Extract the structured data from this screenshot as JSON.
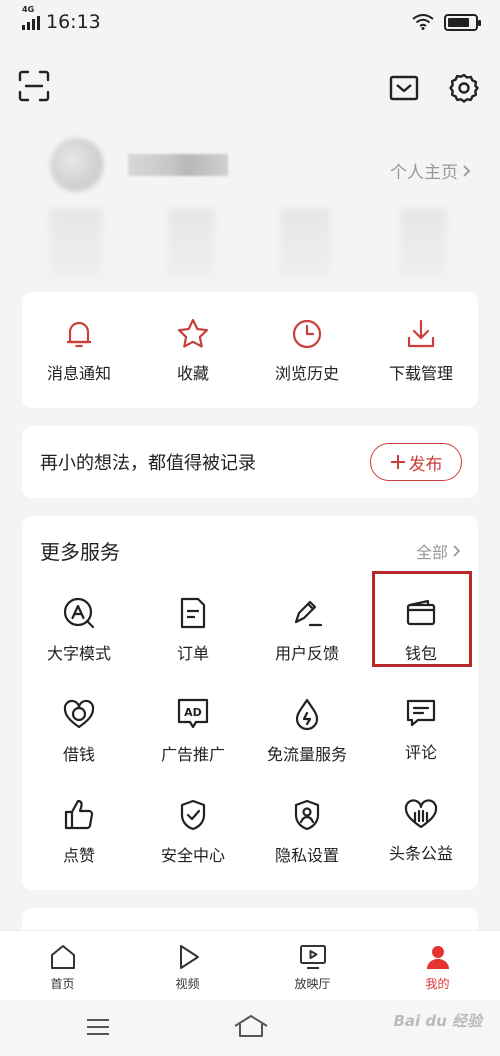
{
  "status_bar": {
    "time": "16:13",
    "network": "4G"
  },
  "profile": {
    "homepage_link": "个人主页"
  },
  "quick_actions": [
    {
      "label": "消息通知",
      "icon": "bell-icon"
    },
    {
      "label": "收藏",
      "icon": "star-icon"
    },
    {
      "label": "浏览历史",
      "icon": "clock-icon"
    },
    {
      "label": "下载管理",
      "icon": "download-icon"
    }
  ],
  "post_bar": {
    "prompt": "再小的想法，都值得被记录",
    "button_label": "发布"
  },
  "services": {
    "title": "更多服务",
    "all_label": "全部",
    "items": [
      {
        "label": "大字模式",
        "icon": "font-size-icon"
      },
      {
        "label": "订单",
        "icon": "order-icon"
      },
      {
        "label": "用户反馈",
        "icon": "feedback-pen-icon"
      },
      {
        "label": "钱包",
        "icon": "wallet-icon"
      },
      {
        "label": "借钱",
        "icon": "loan-icon"
      },
      {
        "label": "广告推广",
        "icon": "ad-icon"
      },
      {
        "label": "免流量服务",
        "icon": "drop-icon"
      },
      {
        "label": "评论",
        "icon": "comment-icon"
      },
      {
        "label": "点赞",
        "icon": "thumbs-up-icon"
      },
      {
        "label": "安全中心",
        "icon": "shield-icon"
      },
      {
        "label": "隐私设置",
        "icon": "privacy-icon"
      },
      {
        "label": "头条公益",
        "icon": "charity-icon"
      }
    ]
  },
  "tab_bar": {
    "tabs": [
      {
        "label": "首页",
        "icon": "home-icon"
      },
      {
        "label": "视频",
        "icon": "play-icon"
      },
      {
        "label": "放映厅",
        "icon": "theater-icon"
      },
      {
        "label": "我的",
        "icon": "user-icon",
        "active": true
      }
    ]
  },
  "watermark": "Bai du 经验",
  "colors": {
    "accent": "#c9403a",
    "active_tab": "#e3342f",
    "highlight_box": "#b8282b"
  }
}
